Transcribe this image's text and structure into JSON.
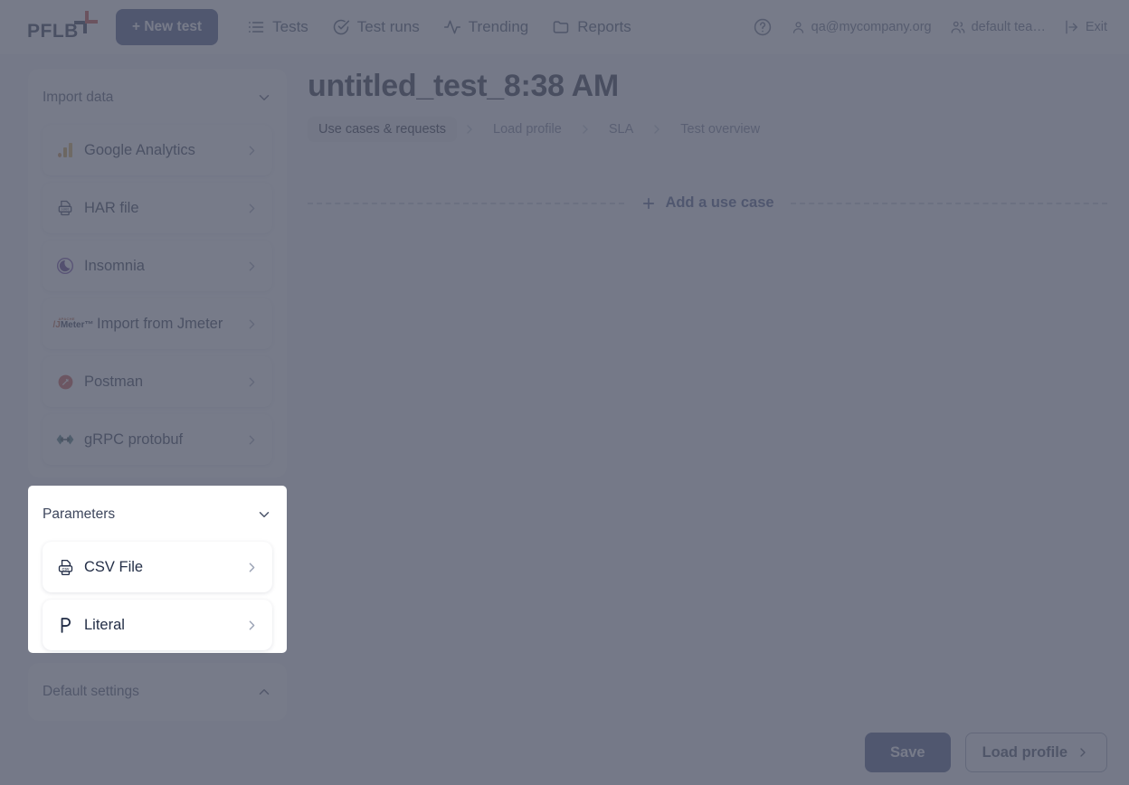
{
  "header": {
    "logo_text": "PFLB",
    "new_test_label": "+ New test",
    "nav": [
      {
        "label": "Tests",
        "icon": "list-icon"
      },
      {
        "label": "Test runs",
        "icon": "check-circle-icon"
      },
      {
        "label": "Trending",
        "icon": "activity-icon"
      },
      {
        "label": "Reports",
        "icon": "folder-icon"
      }
    ],
    "right": [
      {
        "label": "",
        "icon": "help-circle-icon"
      },
      {
        "label": "qa@mycompany.org",
        "icon": "user-icon"
      },
      {
        "label": "default tea…",
        "icon": "users-icon"
      },
      {
        "label": "Exit",
        "icon": "logout-icon"
      }
    ]
  },
  "sidebar": {
    "import": {
      "title": "Import data",
      "collapse_icon": "chevron-down-icon",
      "items": [
        {
          "label": "Google Analytics",
          "icon": "google-analytics-icon"
        },
        {
          "label": "HAR file",
          "icon": "har-file-icon"
        },
        {
          "label": "Insomnia",
          "icon": "insomnia-icon"
        },
        {
          "label": "Import from Jmeter",
          "icon": "jmeter-icon"
        },
        {
          "label": "Postman",
          "icon": "postman-icon"
        },
        {
          "label": "gRPC protobuf",
          "icon": "grpc-icon"
        }
      ]
    },
    "parameters": {
      "title": "Parameters",
      "collapse_icon": "chevron-down-icon",
      "items": [
        {
          "label": "CSV File",
          "icon": "csv-file-icon"
        },
        {
          "label": "Literal",
          "icon": "literal-p-icon"
        }
      ]
    },
    "default_settings": {
      "title": "Default settings",
      "collapse_icon": "chevron-up-icon"
    }
  },
  "main": {
    "title": "untitled_test_8:38 AM",
    "steps": [
      {
        "label": "Use cases & requests",
        "active": true
      },
      {
        "label": "Load profile",
        "active": false
      },
      {
        "label": "SLA",
        "active": false
      },
      {
        "label": "Test overview",
        "active": false
      }
    ],
    "add_use_case": "Add a use case",
    "add_icon": "plus-icon"
  },
  "footer": {
    "save_label": "Save",
    "load_profile_label": "Load profile",
    "load_profile_icon": "chevron-right-icon"
  },
  "colors": {
    "accent": "#3c4a7e",
    "overlay": "#555a6b",
    "panel_bg": "#ffffff",
    "title_text": "#1b2236"
  }
}
